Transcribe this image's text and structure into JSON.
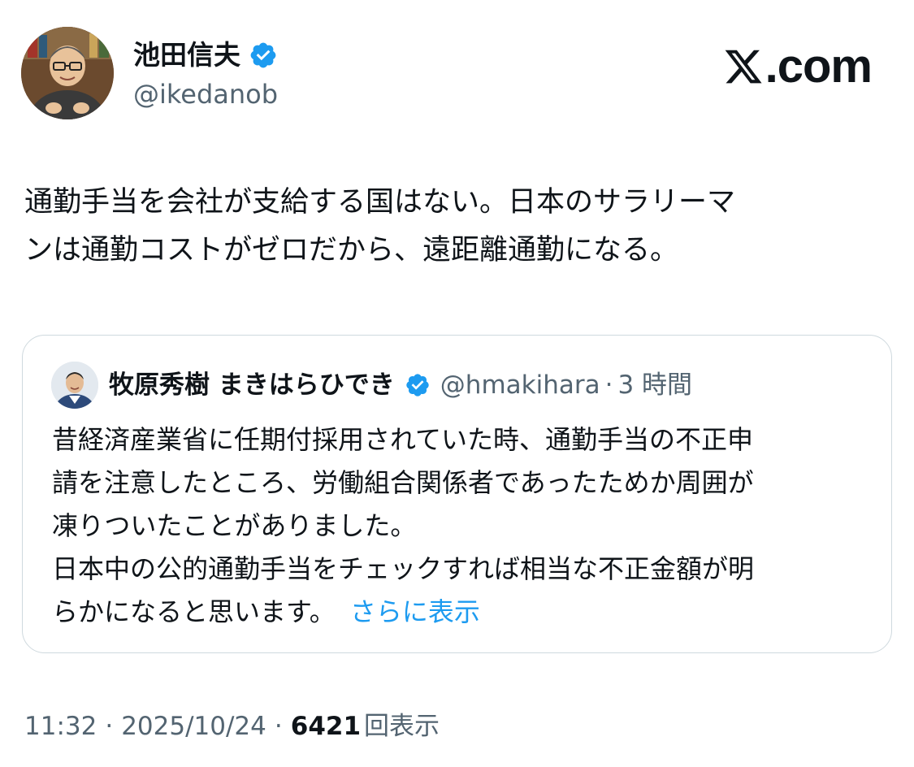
{
  "author": {
    "display_name": "池田信夫",
    "handle": "@ikedanob",
    "verified_icon": "verified-badge-icon",
    "avatar_icon": "avatar-illustration"
  },
  "brand": {
    "text": ".com",
    "logo_icon": "x-logo-icon"
  },
  "tweet": {
    "text": "通勤手当を会社が支給する国はない。日本のサラリーマ\nンは通勤コストがゼロだから、遠距離通勤になる。"
  },
  "quote": {
    "display_name": "牧原秀樹 まきはらひでき",
    "handle": "@hmakihara",
    "separator": "·",
    "time": "3 時間",
    "text": "昔経済産業省に任期付採用されていた時、通勤手当の不正申\n請を注意したところ、労働組合関係者であったためか周囲が\n凍りついたことがありました。\n日本中の公的通勤手当をチェックすれば相当な不正金額が明\nらかになると思います。",
    "show_more": "さらに表示"
  },
  "meta": {
    "time": "11:32",
    "separator": "·",
    "date": "2025/10/24",
    "views_count": "6421",
    "views_label": "回表示"
  },
  "colors": {
    "accent": "#1d9bf0",
    "text": "#0f1419",
    "secondary": "#536471",
    "border": "#cfd9de"
  }
}
